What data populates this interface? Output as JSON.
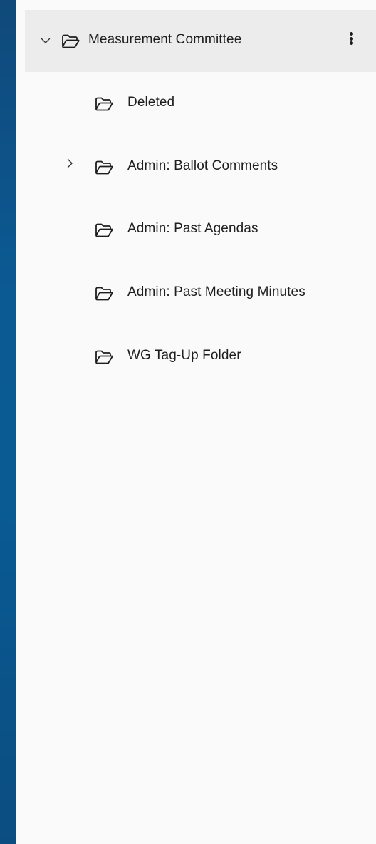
{
  "tree": {
    "root": {
      "label": "Measurement Committee",
      "expanded": true,
      "icon": "folder-open-icon",
      "expander_icon": "chevron-down-icon",
      "menu_icon": "more-vertical-icon"
    },
    "children": [
      {
        "label": "Deleted",
        "icon": "folder-open-icon",
        "has_children": false
      },
      {
        "label": "Admin: Ballot Comments",
        "icon": "folder-open-icon",
        "has_children": true,
        "expander_icon": "chevron-right-icon"
      },
      {
        "label": "Admin: Past Agendas",
        "icon": "folder-open-icon",
        "has_children": false
      },
      {
        "label": "Admin: Past Meeting Minutes",
        "icon": "folder-open-icon",
        "has_children": false
      },
      {
        "label": "WG Tag-Up Folder",
        "icon": "folder-open-icon",
        "has_children": false
      }
    ]
  },
  "colors": {
    "background": "#0b5a94",
    "panel": "#fafafa",
    "selected_row": "#ececec",
    "text": "#1e1e1e"
  }
}
